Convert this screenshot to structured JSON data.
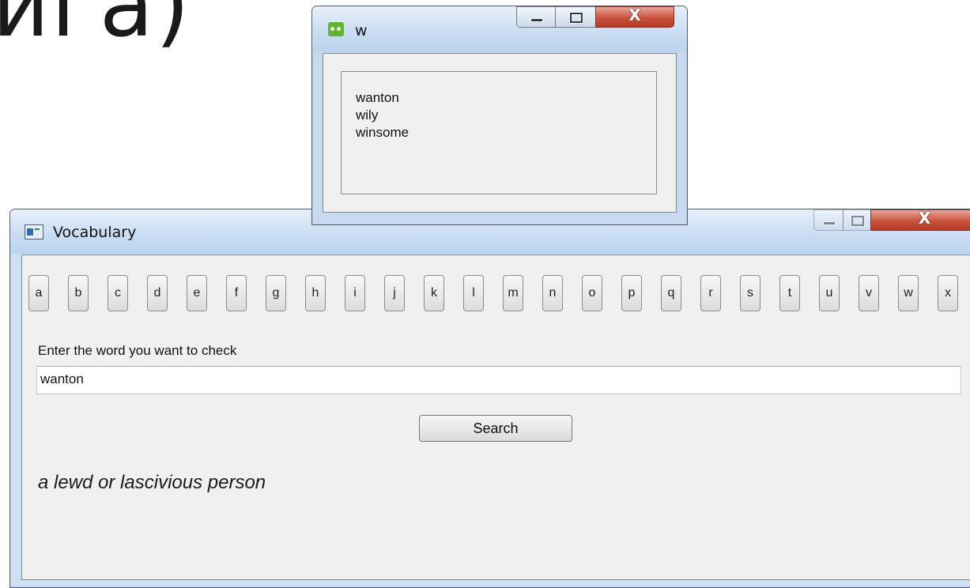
{
  "background_heading": "ига)",
  "words_window": {
    "title": "w",
    "words": [
      "wanton",
      "wily",
      "winsome"
    ],
    "icon": "app-icon-green"
  },
  "vocab_window": {
    "title": "Vocabulary",
    "icon": "app-icon-window",
    "letters": [
      "a",
      "b",
      "c",
      "d",
      "e",
      "f",
      "g",
      "h",
      "i",
      "j",
      "k",
      "l",
      "m",
      "n",
      "o",
      "p",
      "q",
      "r",
      "s",
      "t",
      "u",
      "v",
      "w",
      "x"
    ],
    "prompt": "Enter the word you want to check",
    "entry_value": "wanton",
    "search_label": "Search",
    "definition": "a lewd or lascivious person"
  },
  "window_controls": {
    "minimize_icon": "minimize-icon",
    "maximize_icon": "maximize-icon",
    "close_label": "X"
  },
  "colors": {
    "close_button": "#c9523e",
    "titlebar": "#c9dcf2",
    "client": "#f0f0f0"
  }
}
